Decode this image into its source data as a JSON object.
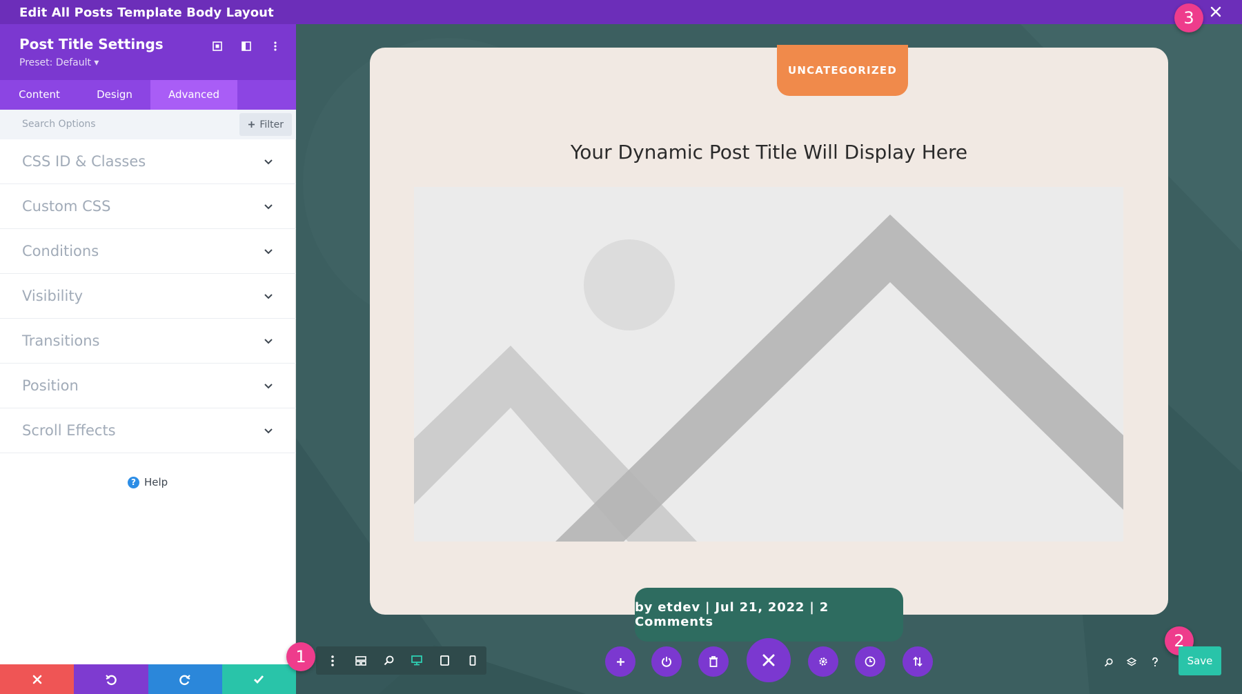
{
  "window": {
    "title": "Edit All Posts Template Body Layout"
  },
  "panel": {
    "title": "Post Title Settings",
    "preset": "Preset: Default ▾",
    "tabs": [
      {
        "label": "Content"
      },
      {
        "label": "Design"
      },
      {
        "label": "Advanced",
        "active": true
      }
    ],
    "search_placeholder": "Search Options",
    "filter_label": "Filter",
    "groups": [
      {
        "label": "CSS ID & Classes"
      },
      {
        "label": "Custom CSS"
      },
      {
        "label": "Conditions"
      },
      {
        "label": "Visibility"
      },
      {
        "label": "Transitions"
      },
      {
        "label": "Position"
      },
      {
        "label": "Scroll Effects"
      }
    ],
    "help_label": "Help"
  },
  "canvas": {
    "category_badge": "UNCATEGORIZED",
    "post_title": "Your Dynamic Post Title Will Display Here",
    "post_meta": "by etdev | Jul 21, 2022 | 2 Comments"
  },
  "toolbar": {
    "save_label": "Save",
    "callouts": [
      "1",
      "2",
      "3"
    ]
  },
  "colors": {
    "topbar": "#6c2eb9",
    "panel_header": "#7b38d0",
    "tab_bar": "#8c45e3",
    "active_tab": "#a95df6",
    "badge": "#f08a4b",
    "meta_box": "#2e6c60",
    "save": "#29c4a9",
    "callout": "#ee3c8c"
  }
}
